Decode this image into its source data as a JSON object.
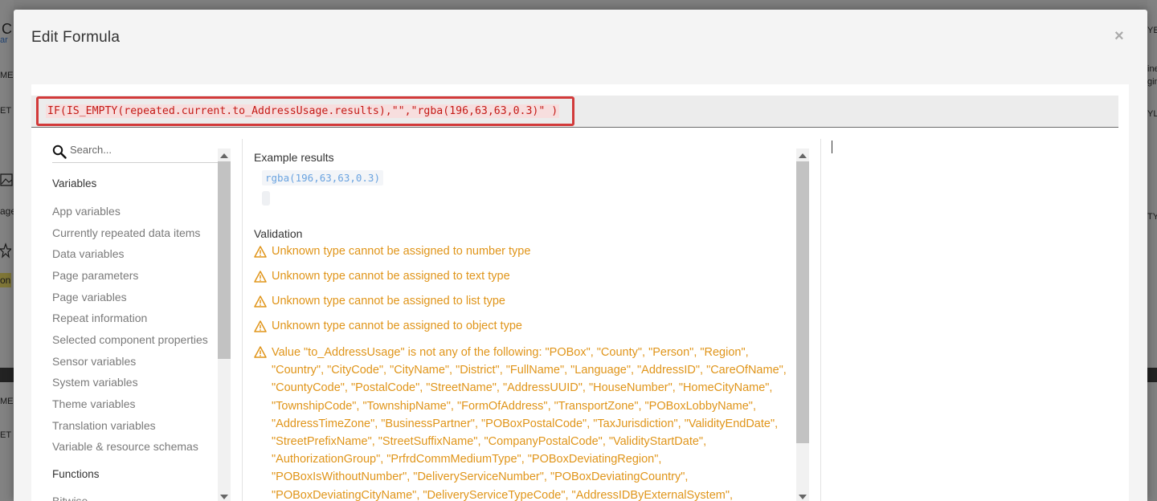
{
  "modal": {
    "title": "Edit Formula",
    "close_label": "×"
  },
  "formula": {
    "text": "IF(IS_EMPTY(repeated.current.to_AddressUsage.results),\"\",\"rgba(196,63,63,0.3)\" )"
  },
  "sidebar": {
    "search_placeholder": "Search...",
    "variables_heading": "Variables",
    "variables": [
      "App variables",
      "Currently repeated data items",
      "Data variables",
      "Page parameters",
      "Page variables",
      "Repeat information",
      "Selected component properties",
      "Sensor variables",
      "System variables",
      "Theme variables",
      "Translation variables",
      "Variable & resource schemas"
    ],
    "functions_heading": "Functions",
    "functions": [
      "Bitwise"
    ]
  },
  "results": {
    "example_label": "Example results",
    "example_value": "rgba(196,63,63,0.3)",
    "validation_label": "Validation",
    "warnings": [
      "Unknown type cannot be assigned to number type",
      "Unknown type cannot be assigned to text type",
      "Unknown type cannot be assigned to list type",
      "Unknown type cannot be assigned to object type"
    ],
    "long_warning": "Value \"to_AddressUsage\" is not any of the following: \"POBox\", \"County\", \"Person\", \"Region\", \"Country\", \"CityCode\", \"CityName\", \"District\", \"FullName\", \"Language\", \"AddressID\", \"CareOfName\", \"CountyCode\", \"PostalCode\", \"StreetName\", \"AddressUUID\", \"HouseNumber\", \"HomeCityName\", \"TownshipCode\", \"TownshipName\", \"FormOfAddress\", \"TransportZone\", \"POBoxLobbyName\", \"AddressTimeZone\", \"BusinessPartner\", \"POBoxPostalCode\", \"TaxJurisdiction\", \"ValidityEndDate\", \"StreetPrefixName\", \"StreetSuffixName\", \"CompanyPostalCode\", \"ValidityStartDate\", \"AuthorizationGroup\", \"PrfrdCommMediumType\", \"POBoxDeviatingRegion\", \"POBoxIsWithoutNumber\", \"DeliveryServiceNumber\", \"POBoxDeviatingCountry\", \"POBoxDeviatingCityName\", \"DeliveryServiceTypeCode\", \"AddressIDByExternalSystem\", \"HouseNumberSupplementText\", \"AdditionalStreetPrefixName\""
  },
  "colors": {
    "warning": "#e0951a",
    "formula_text": "#c41a16",
    "highlight_border": "#d23a3a",
    "example_value": "#6aa3e0"
  },
  "background": {
    "fragments": [
      "C",
      "ar",
      "ME",
      "ET",
      "age",
      "on",
      "ME",
      "ET",
      "ine",
      "gin",
      "YLE",
      "YEL",
      "TYL"
    ]
  }
}
